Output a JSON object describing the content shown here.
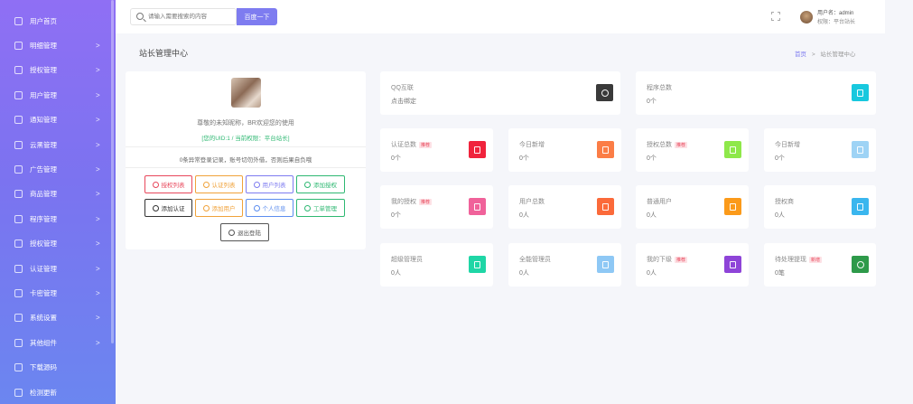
{
  "sidebar": {
    "items": [
      {
        "label": "用户首页",
        "icon": "home-icon",
        "chevron": ""
      },
      {
        "label": "明细管理",
        "icon": "list-icon",
        "chevron": ">"
      },
      {
        "label": "授权管理",
        "icon": "authorize-icon",
        "chevron": ">"
      },
      {
        "label": "用户管理",
        "icon": "user-icon",
        "chevron": ">"
      },
      {
        "label": "通知管理",
        "icon": "bell-icon",
        "chevron": ">"
      },
      {
        "label": "云黑管理",
        "icon": "blacklist-icon",
        "chevron": ">"
      },
      {
        "label": "广告管理",
        "icon": "ad-icon",
        "chevron": ">"
      },
      {
        "label": "商品管理",
        "icon": "cart-icon",
        "chevron": ">"
      },
      {
        "label": "程序管理",
        "icon": "program-icon",
        "chevron": ">"
      },
      {
        "label": "授权管理",
        "icon": "flag-icon",
        "chevron": ">"
      },
      {
        "label": "认证管理",
        "icon": "verify-icon",
        "chevron": ">"
      },
      {
        "label": "卡密管理",
        "icon": "card-icon",
        "chevron": ">"
      },
      {
        "label": "系统设置",
        "icon": "gear-icon",
        "chevron": ">"
      },
      {
        "label": "其他组件",
        "icon": "component-icon",
        "chevron": ">"
      },
      {
        "label": "下载源码",
        "icon": "download-icon",
        "chevron": ""
      },
      {
        "label": "检测更新",
        "icon": "refresh-icon",
        "chevron": ""
      }
    ]
  },
  "header": {
    "search_placeholder": "请输入需要搜索的内容",
    "search_button": "百度一下",
    "user_name": "用户名：admin",
    "user_role": "权限：平台站长"
  },
  "page": {
    "title": "站长管理中心",
    "breadcrumb_home": "首页",
    "breadcrumb_sep": ">",
    "breadcrumb_current": "站长管理中心"
  },
  "profile": {
    "welcome": "尊敬的未知昵称，BR欢迎您的使用",
    "meta": "[您的UID:1 / 当前权限：平台站长]",
    "login_notice": "0条异常登录记录，账号切勿外借，否则后果自负哦",
    "buttons": [
      {
        "label": "授权列表",
        "color": "#e8475b"
      },
      {
        "label": "认证列表",
        "color": "#f0a23a"
      },
      {
        "label": "用户列表",
        "color": "#7e7cf0"
      },
      {
        "label": "添加授权",
        "color": "#2eb872"
      },
      {
        "label": "添加认证",
        "color": "#333333"
      },
      {
        "label": "添加用户",
        "color": "#f0a23a"
      },
      {
        "label": "个人信息",
        "color": "#5b8def"
      },
      {
        "label": "工单管理",
        "color": "#2eb872"
      },
      {
        "label": "退出登陆",
        "color": "#555555"
      }
    ]
  },
  "cards": [
    {
      "label": "QQ互联",
      "badge": "",
      "value": "点击绑定",
      "color": "#3a3a3a",
      "icon": "qq-icon"
    },
    {
      "label": "程序总数",
      "badge": "",
      "value": "0个",
      "color": "#18c8de",
      "icon": "tablet-icon"
    },
    {
      "label": "认证总数",
      "badge": "推荐",
      "value": "0个",
      "color": "#f0233c",
      "icon": "document-icon"
    },
    {
      "label": "今日新增",
      "badge": "",
      "value": "0个",
      "color": "#fb7d46",
      "icon": "document-icon"
    },
    {
      "label": "授权总数",
      "badge": "推荐",
      "value": "0个",
      "color": "#8ee84a",
      "icon": "document-icon"
    },
    {
      "label": "今日新增",
      "badge": "",
      "value": "0个",
      "color": "#9ed3f5",
      "icon": "document-icon"
    },
    {
      "label": "我的授权",
      "badge": "推荐",
      "value": "0个",
      "color": "#f0629a",
      "icon": "document-icon"
    },
    {
      "label": "用户总数",
      "badge": "",
      "value": "0人",
      "color": "#fb6a3a",
      "icon": "document-icon"
    },
    {
      "label": "普通用户",
      "badge": "",
      "value": "0人",
      "color": "#fb9a1a",
      "icon": "document-icon"
    },
    {
      "label": "授权商",
      "badge": "",
      "value": "0人",
      "color": "#3ab6ee",
      "icon": "user-icon"
    },
    {
      "label": "超级管理员",
      "badge": "",
      "value": "0人",
      "color": "#1fd6a6",
      "icon": "document-icon"
    },
    {
      "label": "全能管理员",
      "badge": "",
      "value": "0人",
      "color": "#8ec8f5",
      "icon": "user-icon"
    },
    {
      "label": "我的下级",
      "badge": "推荐",
      "value": "0人",
      "color": "#8e44d8",
      "icon": "user-icon"
    },
    {
      "label": "待处理提现",
      "badge": "新增",
      "value": "0笔",
      "color": "#2e9a4a",
      "icon": "wallet-icon"
    }
  ]
}
